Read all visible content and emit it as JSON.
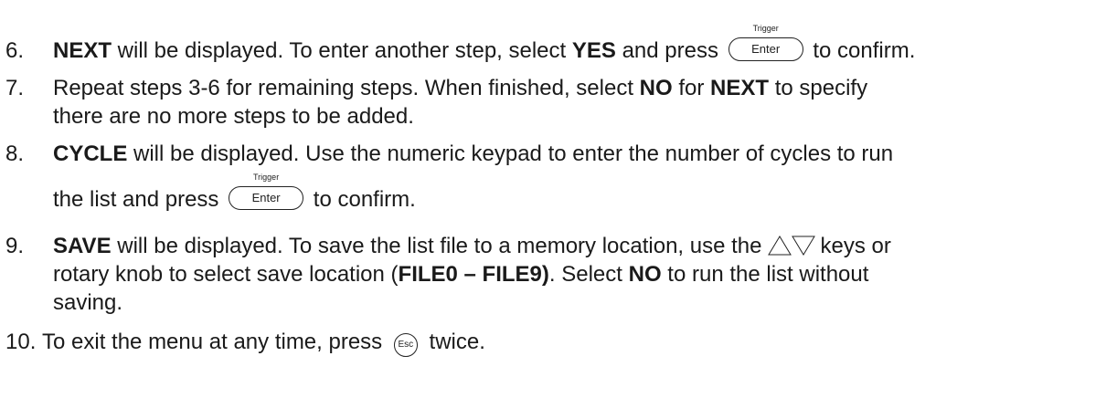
{
  "keys": {
    "trigger_label": "Trigger",
    "enter_label": "Enter",
    "esc_label": "Esc"
  },
  "steps": [
    {
      "number": "6.",
      "bold_next": "NEXT",
      "a": " will be displayed. To enter another step, select ",
      "bold_yes": "YES",
      "b": " and press",
      "c": "to confirm."
    },
    {
      "number": "7.",
      "line1": "Repeat steps 3-6 for remaining steps. When finished, select ",
      "bold_no": "NO",
      "for_text": " for ",
      "bold_next": "NEXT",
      "to_specify": " to specify",
      "line2": "there are no more steps to be added."
    },
    {
      "number": "8.",
      "bold_cycle": "CYCLE",
      "line1": " will be displayed. Use the numeric keypad to enter the number of cycles to run",
      "line2a": "the list and press",
      "line2b": "to confirm."
    },
    {
      "number": "9.",
      "bold_save": "SAVE",
      "line1a": " will be displayed. To save the list file to a memory location, use the",
      "line1b": "keys or",
      "line2a": "rotary knob to select save location (",
      "bold_files": "FILE0 – FILE9)",
      "line2b": ". Select ",
      "bold_no": "NO",
      "line2c": " to run the list without",
      "line3": "saving."
    },
    {
      "number": "10.",
      "a": "To exit the menu at any time, press",
      "b": "twice."
    }
  ]
}
